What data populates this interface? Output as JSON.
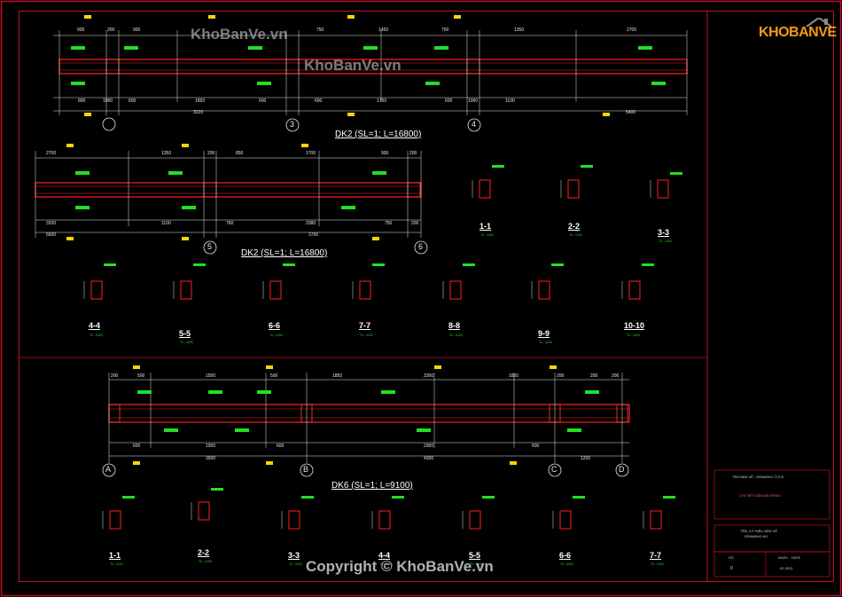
{
  "watermarks": [
    "KhoBanVe.vn",
    "KhoBanVe.vn"
  ],
  "copyright": "Copyright © KhoBanVe.vn",
  "logo": {
    "text": "KHOBANVE"
  },
  "beam_titles": [
    "DK2 (SL=1; L=16800)",
    "DK2 (SL=1; L=16800)",
    "DK6 (SL=1; L=9100)"
  ],
  "beam1": {
    "top_dims": [
      "900",
      "200",
      "900",
      "750",
      "1450",
      "750",
      "1350",
      "2700"
    ],
    "bottom_dims": [
      "800",
      "1060",
      "600",
      "1850",
      "600",
      "600",
      "1750",
      "600",
      "1060",
      "1100",
      "3220",
      "5400"
    ],
    "axes": [
      "3",
      "4"
    ]
  },
  "beam2": {
    "top_dims": [
      "2700",
      "1350",
      "200",
      "850",
      "1700",
      "900",
      "200"
    ],
    "bottom_dims": [
      "3200",
      "1100",
      "760",
      "2080",
      "750",
      "200",
      "5600",
      "3700"
    ],
    "axes": [
      "5",
      "6"
    ]
  },
  "beam3": {
    "top_dims": [
      "200",
      "500",
      "1500",
      "500",
      "1850",
      "2300",
      "1850",
      "200",
      "200",
      "200"
    ],
    "bottom_dims": [
      "600",
      "1900",
      "600",
      "2300",
      "600",
      "3500",
      "4300",
      "1200"
    ],
    "axes": [
      "A",
      "B",
      "C",
      "D"
    ]
  },
  "sections_row1": [
    "1-1",
    "2-2",
    "3-3"
  ],
  "sections_row2": [
    "4-4",
    "5-5",
    "6-6",
    "7-7",
    "8-8",
    "9-9",
    "10-10"
  ],
  "sections_row3": [
    "1-1",
    "2-2",
    "3-3",
    "4-4",
    "5-5",
    "6-6",
    "7-7"
  ],
  "scale_label": "TL: 1/20",
  "title_block": {
    "line1": "TÊN BẢN VẼ - DRAWING TITLE",
    "line2": "CHI TIẾT DẦM ĐÀ KIỀNG",
    "line3": "TÊN, KÝ HIỆU BẢN VẼ",
    "line4": "DRAWING NO",
    "line5": "NGÀY - DATE",
    "line6": "SỐ",
    "value_no": "0",
    "value_date": "02-2021"
  },
  "colors": {
    "border": "#c0102a",
    "beam": "#ff2020",
    "rebar_label": "#21e021",
    "dim": "#e8e8e8",
    "tick": "#ffd400"
  }
}
